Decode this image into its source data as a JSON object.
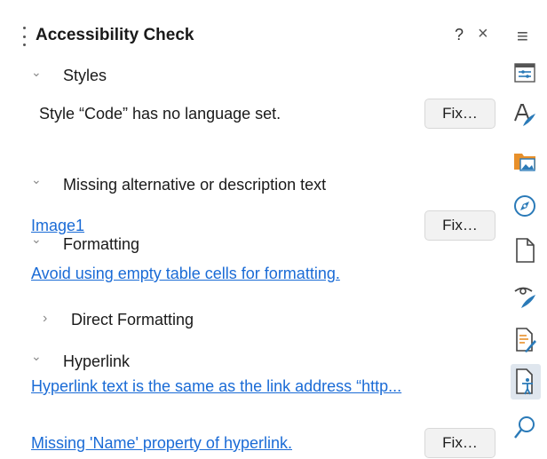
{
  "panel": {
    "title": "Accessibility Check",
    "help_label": "?",
    "close_label": "×"
  },
  "categories": {
    "styles": {
      "label": "Styles",
      "chevron": "⌄"
    },
    "alt_text": {
      "label": "Missing alternative or description text",
      "chevron": "⌄"
    },
    "formatting": {
      "label": "Formatting",
      "chevron": "⌄"
    },
    "direct_formatting": {
      "label": "Direct Formatting",
      "chevron": "›"
    },
    "hyperlink": {
      "label": "Hyperlink",
      "chevron": "⌄"
    }
  },
  "issues": {
    "style_code": {
      "text": "Style “Code” has no language set.",
      "fix_label": "Fix…"
    },
    "image1": {
      "text": "Image1",
      "fix_label": "Fix…"
    },
    "empty_cells": {
      "text": "Avoid using empty table cells for formatting."
    },
    "hyperlink_same": {
      "text": "Hyperlink text is the same as the link address “http..."
    },
    "hyperlink_name": {
      "text": "Missing 'Name' property of hyperlink.",
      "fix_label": "Fix…"
    }
  },
  "sidebar": {
    "menu_glyph": "≡",
    "icons": [
      "properties-icon",
      "styles-icon",
      "gallery-icon",
      "navigator-icon",
      "page-icon",
      "style-inspector-icon",
      "manage-changes-icon",
      "accessibility-check-icon",
      "find-icon"
    ],
    "active_icon": "accessibility-check-icon"
  },
  "colors": {
    "link": "#1a6bd6",
    "accent_blue": "#2a7ab8",
    "folder_orange": "#e8902a",
    "active_bg": "#dfe6ee"
  }
}
